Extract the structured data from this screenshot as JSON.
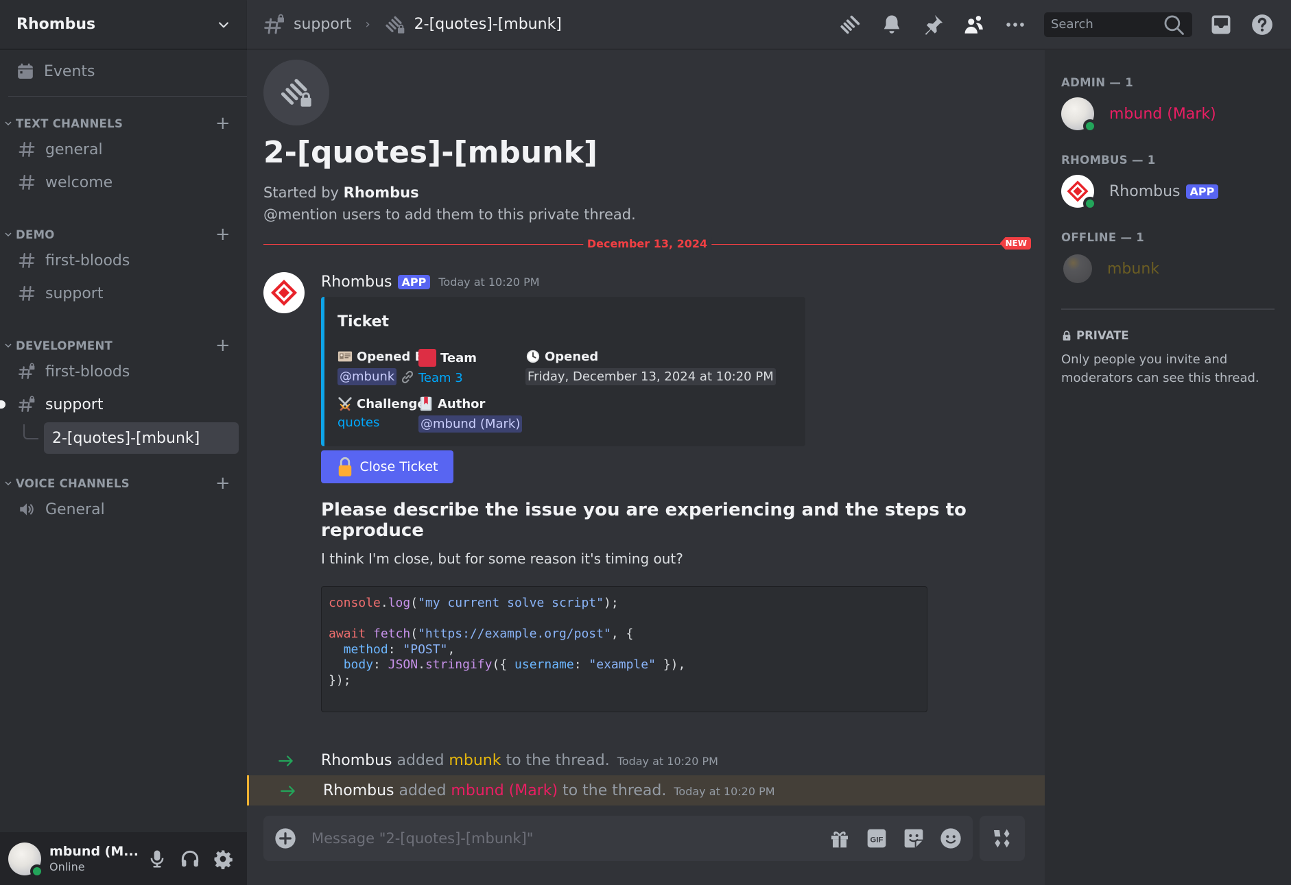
{
  "server": {
    "name": "Rhombus",
    "events_label": "Events",
    "categories": [
      {
        "label": "TEXT CHANNELS",
        "channels": [
          {
            "name": "general",
            "icon": "hash-icon",
            "private": false
          },
          {
            "name": "welcome",
            "icon": "hash-icon",
            "private": false
          }
        ]
      },
      {
        "label": "DEMO",
        "channels": [
          {
            "name": "first-bloods",
            "icon": "hash-icon",
            "private": false
          },
          {
            "name": "support",
            "icon": "hash-icon",
            "private": false
          }
        ]
      },
      {
        "label": "DEVELOPMENT",
        "channels": [
          {
            "name": "first-bloods",
            "icon": "private-hash-icon",
            "private": true
          },
          {
            "name": "support",
            "icon": "private-hash-icon",
            "private": true,
            "unread": true
          },
          {
            "thread": "2-[quotes]-[mbunk]",
            "selected": true
          }
        ]
      },
      {
        "label": "VOICE CHANNELS",
        "channels": [
          {
            "name": "General",
            "icon": "speaker-icon",
            "private": false
          }
        ]
      }
    ]
  },
  "user_panel": {
    "name": "mbund (M...",
    "status": "Online"
  },
  "topbar": {
    "parent_channel": "support",
    "thread_name": "2-[quotes]-[mbunk]",
    "search_placeholder": "Search"
  },
  "thread": {
    "title": "2-[quotes]-[mbunk]",
    "started_by_prefix": "Started by",
    "started_by": "Rhombus",
    "hint": "@mention users to add them to this private thread."
  },
  "date_divider": {
    "label": "December 13, 2024",
    "new_badge": "NEW"
  },
  "message": {
    "author": "Rhombus",
    "app_tag": "APP",
    "timestamp": "Today at 10:20 PM",
    "embed": {
      "title": "Ticket",
      "accent": "#0ea5e9",
      "fields": {
        "opened_by": {
          "name": "Opened By",
          "value": "@mbunk"
        },
        "team": {
          "name": "Team",
          "value": "Team 3",
          "color": "#dd2e44"
        },
        "opened": {
          "name": "Opened",
          "value": "Friday, December 13, 2024 at 10:20 PM"
        },
        "challenge": {
          "name": "Challenge",
          "value": "quotes"
        },
        "author": {
          "name": "Author",
          "value": "@mbund (Mark)"
        }
      }
    },
    "button": {
      "label": "Close Ticket",
      "color": "#5865f2"
    },
    "heading": "Please describe the issue you are experiencing and the steps to reproduce",
    "paragraph": "I think I'm close, but for some reason it's timing out?",
    "code": {
      "language": "javascript",
      "lines": [
        "console.log(\"my current solve script\");",
        "",
        "await fetch(\"https://example.org/post\", {",
        "  method: \"POST\",",
        "  body: JSON.stringify({ username: \"example\" }),",
        "});"
      ]
    }
  },
  "system_messages": [
    {
      "actor": "Rhombus",
      "verb": "added",
      "target": "mbunk",
      "target_color": "#e6b70c",
      "suffix": "to the thread.",
      "timestamp": "Today at 10:20 PM",
      "highlighted": false
    },
    {
      "actor": "Rhombus",
      "verb": "added",
      "target": "mbund (Mark)",
      "target_color": "#e91e63",
      "suffix": "to the thread.",
      "timestamp": "Today at 10:20 PM",
      "highlighted": true
    }
  ],
  "composer": {
    "placeholder": "Message \"2-[quotes]-[mbunk]\""
  },
  "members": {
    "groups": [
      {
        "label": "ADMIN — 1",
        "members": [
          {
            "name": "mbund (Mark)",
            "color": "#e91e63",
            "status": "online"
          }
        ]
      },
      {
        "label": "RHOMBUS — 1",
        "members": [
          {
            "name": "Rhombus",
            "tag": "APP",
            "status": "online"
          }
        ]
      },
      {
        "label": "OFFLINE — 1",
        "members": [
          {
            "name": "mbunk",
            "status": "offline"
          }
        ]
      }
    ],
    "private_heading": "PRIVATE",
    "private_text": "Only people you invite and moderators can see this thread."
  }
}
